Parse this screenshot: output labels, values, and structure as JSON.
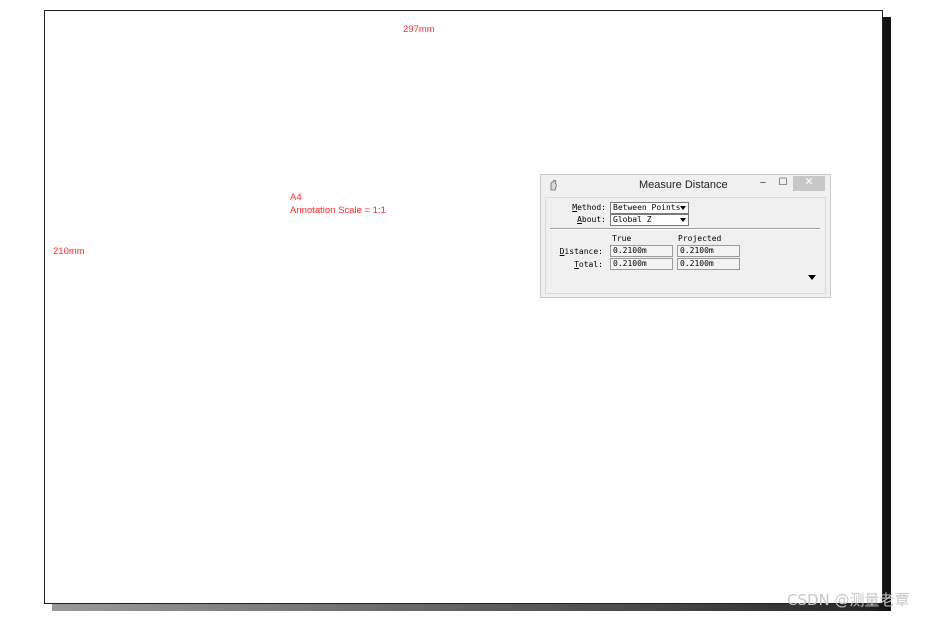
{
  "sheet": {
    "width_label": "297mm",
    "height_label": "210mm",
    "paper_label": "A4",
    "annotation_scale": "Annotation Scale = 1:1"
  },
  "dialog": {
    "title": "Measure Distance",
    "icon": "measure-tool-icon",
    "minimize_glyph": "–",
    "maximize_glyph": "☐",
    "close_glyph": "✕",
    "method": {
      "label": "Method:",
      "value": "Between Points"
    },
    "about": {
      "label": "About:",
      "value": "Global Z"
    },
    "columns": {
      "true_label": "True",
      "projected_label": "Projected"
    },
    "rows": {
      "distance": {
        "label": "Distance:",
        "true": "0.2100m",
        "projected": "0.2100m"
      },
      "total": {
        "label": "Total:",
        "true": "0.2100m",
        "projected": "0.2100m"
      }
    },
    "expand_icon": "triangle-down-icon"
  },
  "watermark": "CSDN @测量老覃",
  "colors": {
    "annotation": "#ff2a2a",
    "close_button": "#c7c7c7"
  }
}
